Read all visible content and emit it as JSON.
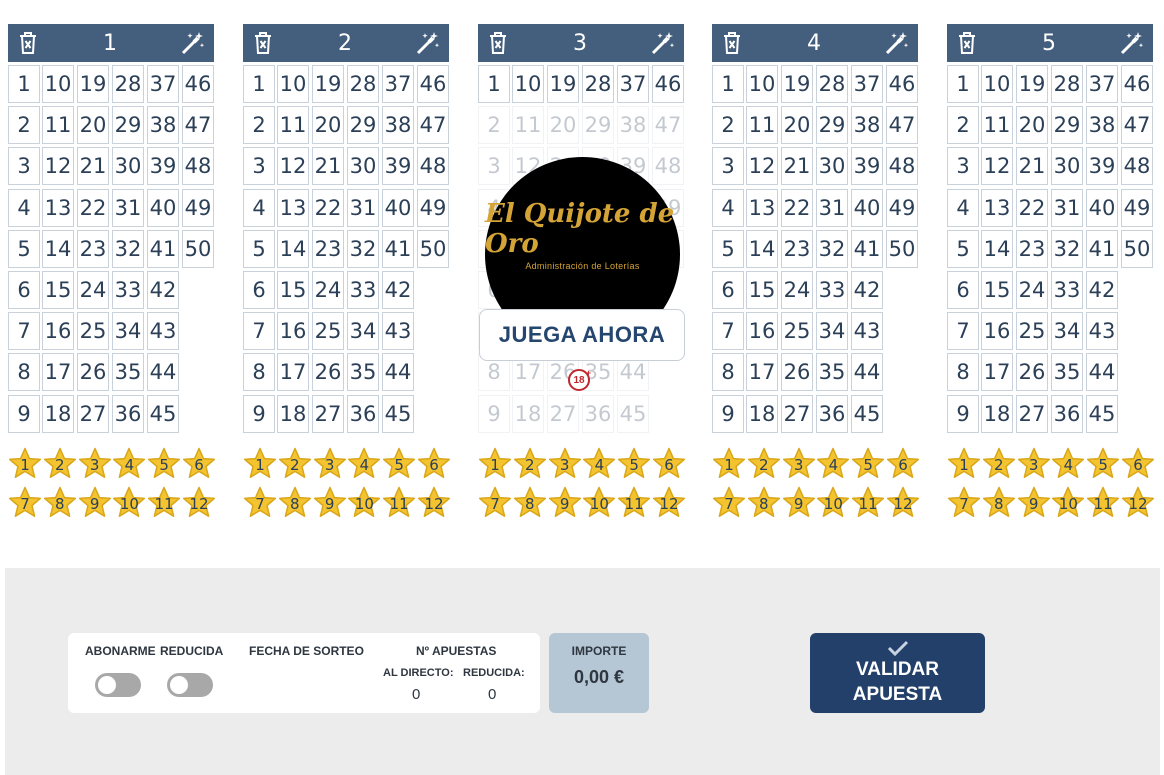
{
  "boards": [
    {
      "title": "1"
    },
    {
      "title": "2"
    },
    {
      "title": "3"
    },
    {
      "title": "4"
    },
    {
      "title": "5"
    }
  ],
  "board_icons": {
    "left": "trash-icon",
    "right": "magic-wand-icon"
  },
  "numbers_min": 1,
  "numbers_max": 50,
  "stars_min": 1,
  "stars_max": 12,
  "ad": {
    "logo": "El Quijote de Oro",
    "subtitle": "Administración de Loterías",
    "button": "JUEGA AHORA",
    "age_badge": "18"
  },
  "footer": {
    "abonarme": "ABONARME",
    "reducida": "REDUCIDA",
    "fecha": "FECHA DE SORTEO",
    "apuestas": "Nº APUESTAS",
    "al_directo": "AL DIRECTO:",
    "reducida_sub": "REDUCIDA:",
    "al_directo_value": "0",
    "reducida_value": "0",
    "importe_label": "IMPORTE",
    "importe_value": "0,00 €",
    "validar_line1": "VALIDAR",
    "validar_line2": "APUESTA"
  },
  "colors": {
    "header": "#445f7d",
    "number_text": "#2b3f57",
    "star_fill": "#f4c430",
    "star_stroke": "#d9a617",
    "validar_bg": "#22406a",
    "importe_bg": "#b5c6d5"
  }
}
